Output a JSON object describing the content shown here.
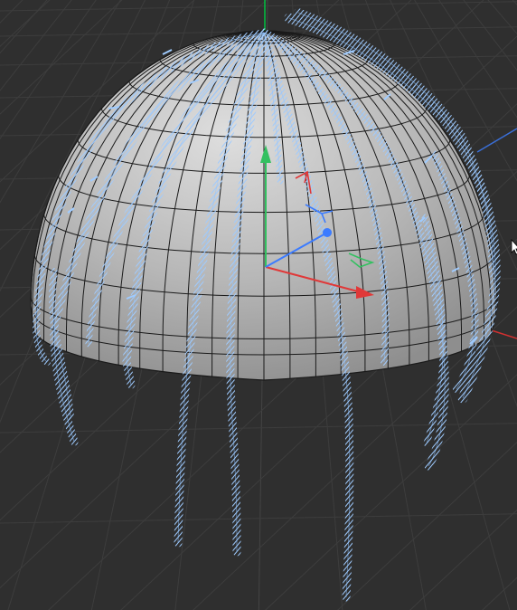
{
  "viewport": {
    "background": "#2f2f2f",
    "grid_color": "#3d3d3d",
    "description_visible_text": ""
  },
  "scene": {
    "object": "hemisphere",
    "object_color": "#b8b8b8",
    "wireframe_color": "#1a1a1a",
    "hair_color": "#8fc3ff",
    "view_axis_green": "#00c040",
    "view_axis_blue": "#3a6fd8",
    "view_axis_red": "#d03030"
  },
  "gizmo": {
    "type": "move-gizmo",
    "x_axis_color": "#e03838",
    "y_axis_color": "#33c060",
    "z_axis_color": "#3b7bff",
    "plane_handle_xy_color": "#e03838",
    "plane_handle_yz_color": "#33c060",
    "plane_handle_xz_color": "#3b7bff"
  },
  "cursor": {
    "icon": "arrow-cursor-icon"
  }
}
